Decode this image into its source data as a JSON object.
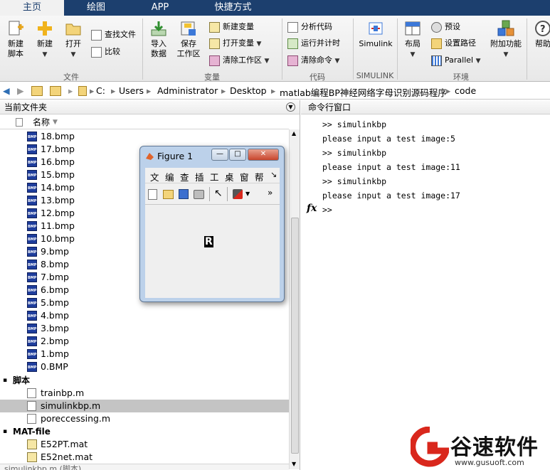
{
  "tabs": [
    "主页",
    "绘图",
    "APP",
    "快捷方式"
  ],
  "toolbar": {
    "new_script": "新建\n脚本",
    "new": "新建",
    "open": "打开",
    "find_files": "查找文件",
    "compare": "比较",
    "import_data": "导入\n数据",
    "save_workspace": "保存\n工作区",
    "new_variable": "新建变量",
    "open_variable": "打开变量",
    "clear_workspace": "清除工作区",
    "analyze_code": "分析代码",
    "run_and_time": "运行并计时",
    "clear_commands": "清除命令",
    "simulink": "Simulink",
    "layout": "布局",
    "preferences": "预设",
    "set_path": "设置路径",
    "parallel": "Parallel",
    "addons": "附加功能",
    "help": "帮助",
    "groups": {
      "file": "文件",
      "variable": "变量",
      "code": "代码",
      "simulink": "SIMULINK",
      "environment": "环境"
    }
  },
  "address": {
    "path": [
      "C:",
      "Users",
      "Administrator",
      "Desktop",
      "matlab编程BP神经网络字母识别源码程序",
      "code"
    ]
  },
  "file_browser": {
    "title": "当前文件夹",
    "column_name": "名称",
    "bmp_files": [
      "18.bmp",
      "17.bmp",
      "16.bmp",
      "15.bmp",
      "14.bmp",
      "13.bmp",
      "12.bmp",
      "11.bmp",
      "10.bmp",
      "9.bmp",
      "8.bmp",
      "7.bmp",
      "6.bmp",
      "5.bmp",
      "4.bmp",
      "3.bmp",
      "2.bmp",
      "1.bmp",
      "0.BMP"
    ],
    "bmp_badge": "BMP",
    "scripts_section": "脚本",
    "scripts": [
      "trainbp.m",
      "simulinkbp.m",
      "poreccessing.m"
    ],
    "selected_script": "simulinkbp.m",
    "mat_section": "MAT-file",
    "mat_files": [
      "E52PT.mat",
      "E52net.mat"
    ],
    "footer_partial": "simulinkbp.m (脚本)"
  },
  "command_window": {
    "title": "命令行窗口",
    "fx": "fx",
    "lines": [
      ">> simulinkbp",
      "please input a test image:5",
      ">> simulinkbp",
      "please input a test image:11",
      ">> simulinkbp",
      "please input a test image:17",
      ">>"
    ]
  },
  "figure": {
    "title": "Figure 1",
    "menu": [
      "文",
      "编",
      "查",
      "插",
      "工",
      "桌",
      "窗",
      "帮"
    ],
    "glyph": "R",
    "more": "»",
    "minimize": "—",
    "maximize": "□",
    "close": "✕"
  },
  "watermark": {
    "brand": "谷速软件",
    "url": "www.gusuoft.com"
  },
  "colors": {
    "tab_bar": "#1c3f6e",
    "selected_row": "#c4c4c4",
    "logo_red": "#d9271c"
  }
}
